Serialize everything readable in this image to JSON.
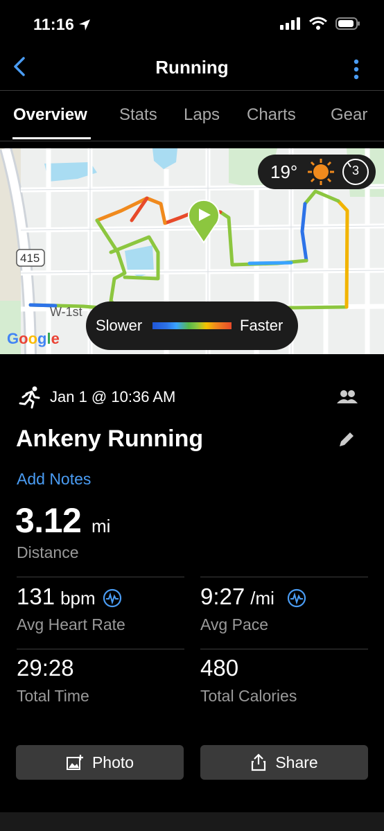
{
  "status_bar": {
    "time": "11:16"
  },
  "header": {
    "title": "Running"
  },
  "tabs": [
    {
      "label": "Overview"
    },
    {
      "label": "Stats"
    },
    {
      "label": "Laps"
    },
    {
      "label": "Charts"
    },
    {
      "label": "Gear"
    }
  ],
  "map": {
    "temperature": "19°",
    "wind": "3",
    "road_label": "415",
    "street_label": "W-1st",
    "speed_legend": {
      "slower": "Slower",
      "faster": "Faster"
    },
    "attribution": "Google"
  },
  "activity": {
    "datetime": "Jan 1 @ 10:36 AM",
    "name": "Ankeny Running",
    "add_notes": "Add Notes",
    "distance": {
      "value": "3.12",
      "unit": "mi",
      "label": "Distance"
    },
    "stats": [
      {
        "value": "131",
        "unit": "bpm",
        "label": "Avg Heart Rate"
      },
      {
        "value": "9:27",
        "unit": "/mi",
        "label": "Avg Pace"
      },
      {
        "value": "29:28",
        "unit": "",
        "label": "Total Time"
      },
      {
        "value": "480",
        "unit": "",
        "label": "Total Calories"
      }
    ]
  },
  "actions": {
    "photo": "Photo",
    "share": "Share"
  },
  "colors": {
    "accent": "#4a9cf3",
    "background": "#000000",
    "button": "#3a3a3a"
  },
  "icons": [
    "back-icon",
    "more-options-icon",
    "sun-icon",
    "wind-icon",
    "run-icon",
    "group-icon",
    "edit-icon",
    "heart-rate-icon",
    "add-photo-icon",
    "share-icon"
  ]
}
